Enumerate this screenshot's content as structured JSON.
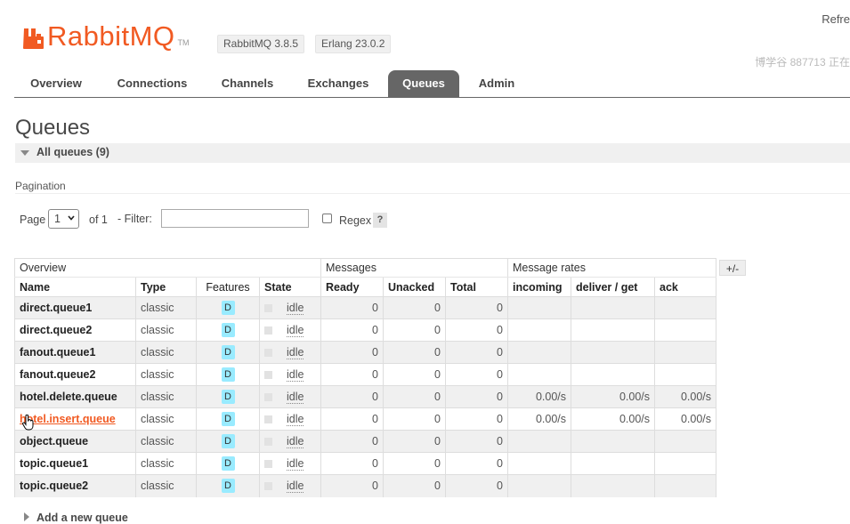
{
  "header": {
    "logo_text": "RabbitMQ",
    "logo_tm": "TM",
    "rabbitmq_version": "RabbitMQ 3.8.5",
    "erlang_version": "Erlang 23.0.2",
    "refresh_text": "Refre",
    "user_info": "博学谷 887713 正在"
  },
  "nav": {
    "tabs": [
      "Overview",
      "Connections",
      "Channels",
      "Exchanges",
      "Queues",
      "Admin"
    ],
    "active": "Queues"
  },
  "page": {
    "title": "Queues",
    "section_label": "All queues (9)",
    "pagination_label": "Pagination",
    "page_label": "Page",
    "page_value": "1",
    "of_label": "of 1",
    "filter_label": "- Filter:",
    "filter_value": "",
    "regex_label": "Regex",
    "regex_help": "?",
    "add_queue_label": "Add a new queue"
  },
  "table": {
    "groups": [
      "Overview",
      "Messages",
      "Message rates"
    ],
    "toggle_label": "+/-",
    "columns": [
      "Name",
      "Type",
      "Features",
      "State",
      "Ready",
      "Unacked",
      "Total",
      "incoming",
      "deliver / get",
      "ack"
    ],
    "rows": [
      {
        "name": "direct.queue1",
        "type": "classic",
        "feature": "D",
        "state": "idle",
        "ready": "0",
        "unacked": "0",
        "total": "0",
        "incoming": "",
        "deliver_get": "",
        "ack": ""
      },
      {
        "name": "direct.queue2",
        "type": "classic",
        "feature": "D",
        "state": "idle",
        "ready": "0",
        "unacked": "0",
        "total": "0",
        "incoming": "",
        "deliver_get": "",
        "ack": ""
      },
      {
        "name": "fanout.queue1",
        "type": "classic",
        "feature": "D",
        "state": "idle",
        "ready": "0",
        "unacked": "0",
        "total": "0",
        "incoming": "",
        "deliver_get": "",
        "ack": ""
      },
      {
        "name": "fanout.queue2",
        "type": "classic",
        "feature": "D",
        "state": "idle",
        "ready": "0",
        "unacked": "0",
        "total": "0",
        "incoming": "",
        "deliver_get": "",
        "ack": ""
      },
      {
        "name": "hotel.delete.queue",
        "type": "classic",
        "feature": "D",
        "state": "idle",
        "ready": "0",
        "unacked": "0",
        "total": "0",
        "incoming": "0.00/s",
        "deliver_get": "0.00/s",
        "ack": "0.00/s"
      },
      {
        "name": "hotel.insert.queue",
        "type": "classic",
        "feature": "D",
        "state": "idle",
        "ready": "0",
        "unacked": "0",
        "total": "0",
        "incoming": "0.00/s",
        "deliver_get": "0.00/s",
        "ack": "0.00/s"
      },
      {
        "name": "object.queue",
        "type": "classic",
        "feature": "D",
        "state": "idle",
        "ready": "0",
        "unacked": "0",
        "total": "0",
        "incoming": "",
        "deliver_get": "",
        "ack": ""
      },
      {
        "name": "topic.queue1",
        "type": "classic",
        "feature": "D",
        "state": "idle",
        "ready": "0",
        "unacked": "0",
        "total": "0",
        "incoming": "",
        "deliver_get": "",
        "ack": ""
      },
      {
        "name": "topic.queue2",
        "type": "classic",
        "feature": "D",
        "state": "idle",
        "ready": "0",
        "unacked": "0",
        "total": "0",
        "incoming": "",
        "deliver_get": "",
        "ack": ""
      }
    ],
    "highlighted_row": "hotel.insert.queue"
  },
  "colors": {
    "brand": "#f15a22",
    "active_tab": "#666666",
    "feature_badge": "#99ebff"
  }
}
